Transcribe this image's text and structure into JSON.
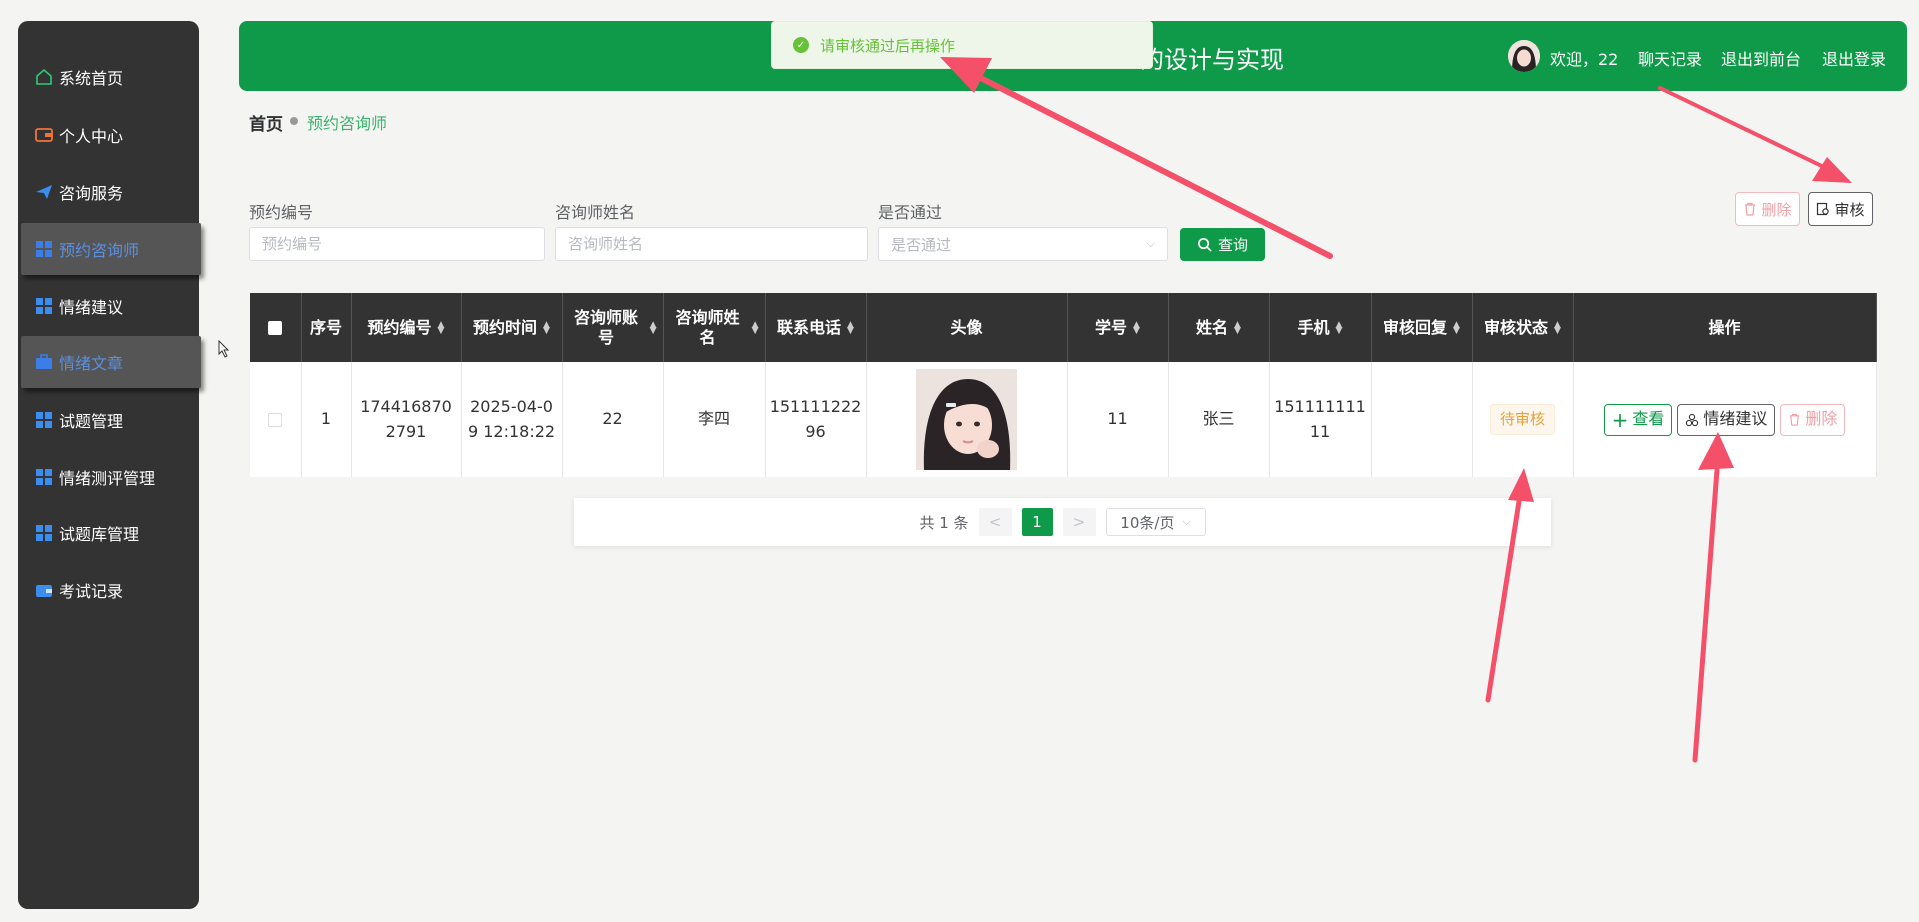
{
  "sidebar": {
    "items": [
      {
        "label": "系统首页",
        "icon": "home-icon"
      },
      {
        "label": "个人中心",
        "icon": "wallet-icon"
      },
      {
        "label": "咨询服务",
        "icon": "paper-plane-icon"
      },
      {
        "label": "预约咨询师",
        "icon": "grid-icon"
      },
      {
        "label": "情绪建议",
        "icon": "grid-icon"
      },
      {
        "label": "情绪文章",
        "icon": "briefcase-icon"
      },
      {
        "label": "试题管理",
        "icon": "grid-icon"
      },
      {
        "label": "情绪测评管理",
        "icon": "grid-icon"
      },
      {
        "label": "试题库管理",
        "icon": "grid-icon"
      },
      {
        "label": "考试记录",
        "icon": "wallet-icon"
      }
    ]
  },
  "header": {
    "title": "的设计与实现",
    "welcome": "欢迎，22",
    "links": [
      "聊天记录",
      "退出到前台",
      "退出登录"
    ]
  },
  "toast": {
    "message": "请审核通过后再操作"
  },
  "breadcrumb": {
    "home": "首页",
    "current": "预约咨询师"
  },
  "search": {
    "fields": [
      {
        "label": "预约编号",
        "placeholder": "预约编号"
      },
      {
        "label": "咨询师姓名",
        "placeholder": "咨询师姓名"
      },
      {
        "label": "是否通过",
        "placeholder": "是否通过"
      }
    ],
    "query_label": "查询"
  },
  "actions": {
    "delete_label": "删除",
    "audit_label": "审核"
  },
  "table": {
    "headers": [
      "序号",
      "预约编号",
      "预约时间",
      "咨询师账号",
      "咨询师姓名",
      "联系电话",
      "头像",
      "学号",
      "姓名",
      "手机",
      "审核回复",
      "审核状态",
      "操作"
    ],
    "rows": [
      {
        "index": "1",
        "booking_no": "1744168702791",
        "booking_time": "2025-04-09 12:18:22",
        "counselor_account": "22",
        "counselor_name": "李四",
        "phone": "15111122296",
        "student_no": "11",
        "name": "张三",
        "mobile": "15111111111",
        "reply": "",
        "status": "待审核",
        "ops": {
          "view": "查看",
          "suggest": "情绪建议",
          "delete": "删除"
        }
      }
    ]
  },
  "pagination": {
    "total": "共 1 条",
    "prev": "<",
    "current": "1",
    "next": ">",
    "page_size": "10条/页"
  },
  "colors": {
    "brand": "#0e9a48",
    "sidebar": "#333333",
    "danger": "#f56c6c",
    "warning": "#e6a23c",
    "annotation": "#f4506a"
  }
}
